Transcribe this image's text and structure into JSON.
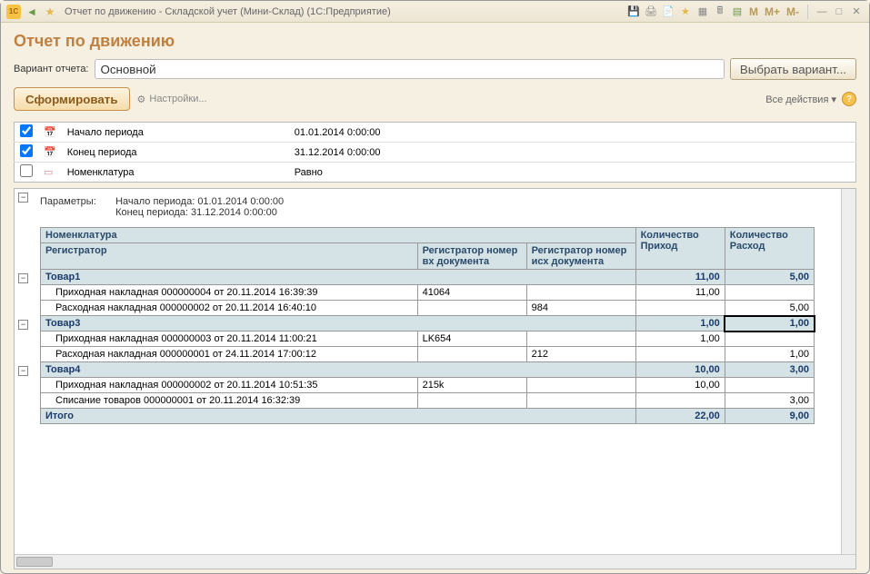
{
  "window": {
    "title": "Отчет по движению - Складской учет (Мини-Склад)  (1С:Предприятие)"
  },
  "page": {
    "title": "Отчет по движению"
  },
  "variant": {
    "label": "Вариант отчета:",
    "value": "Основной",
    "choose_btn": "Выбрать вариант..."
  },
  "toolbar": {
    "form_btn": "Сформировать",
    "settings": "Настройки...",
    "actions": "Все действия"
  },
  "filters": {
    "rows": [
      {
        "checked": true,
        "icon": "calendar",
        "label": "Начало периода",
        "value": "01.01.2014 0:00:00"
      },
      {
        "checked": true,
        "icon": "calendar",
        "label": "Конец периода",
        "value": "31.12.2014 0:00:00"
      },
      {
        "checked": false,
        "icon": "book",
        "label": "Номенклатура",
        "value": "Равно"
      }
    ]
  },
  "params": {
    "label": "Параметры:",
    "l1a": "Начало периода: ",
    "l1b": "01.01.2014 0:00:00",
    "l2a": "Конец периода: ",
    "l2b": "31.12.2014 0:00:00"
  },
  "headers": {
    "h_nomen": "Номенклатура",
    "h_reg": "Регистратор",
    "h_regin": "Регистратор номер вх документа",
    "h_regout": "Регистратор номер исх документа",
    "h_qtyin": "Количество Приход",
    "h_qtyout": "Количество Расход"
  },
  "rows": [
    {
      "type": "group",
      "name": "Товар1",
      "qin": "11,00",
      "qout": "5,00"
    },
    {
      "type": "detail",
      "name": "Приходная накладная 000000004 от 20.11.2014 16:39:39",
      "c2": "41064",
      "c3": "",
      "qin": "11,00",
      "qout": ""
    },
    {
      "type": "detail",
      "name": "Расходная накладная 000000002 от 20.11.2014 16:40:10",
      "c2": "",
      "c3": "984",
      "qin": "",
      "qout": "5,00"
    },
    {
      "type": "group",
      "name": "Товар3",
      "qin": "1,00",
      "qout": "1,00",
      "hl": true
    },
    {
      "type": "detail",
      "name": "Приходная накладная 000000003 от 20.11.2014 11:00:21",
      "c2": "LK654",
      "c3": "",
      "qin": "1,00",
      "qout": ""
    },
    {
      "type": "detail",
      "name": "Расходная накладная 000000001 от 24.11.2014 17:00:12",
      "c2": "",
      "c3": "212",
      "qin": "",
      "qout": "1,00"
    },
    {
      "type": "group",
      "name": "Товар4",
      "qin": "10,00",
      "qout": "3,00"
    },
    {
      "type": "detail",
      "name": "Приходная накладная 000000002 от 20.11.2014 10:51:35",
      "c2": "215k",
      "c3": "",
      "qin": "10,00",
      "qout": ""
    },
    {
      "type": "detail",
      "name": "Списание товаров 000000001 от 20.11.2014 16:32:39",
      "c2": "",
      "c3": "",
      "qin": "",
      "qout": "3,00"
    },
    {
      "type": "total",
      "name": "Итого",
      "qin": "22,00",
      "qout": "9,00"
    }
  ]
}
